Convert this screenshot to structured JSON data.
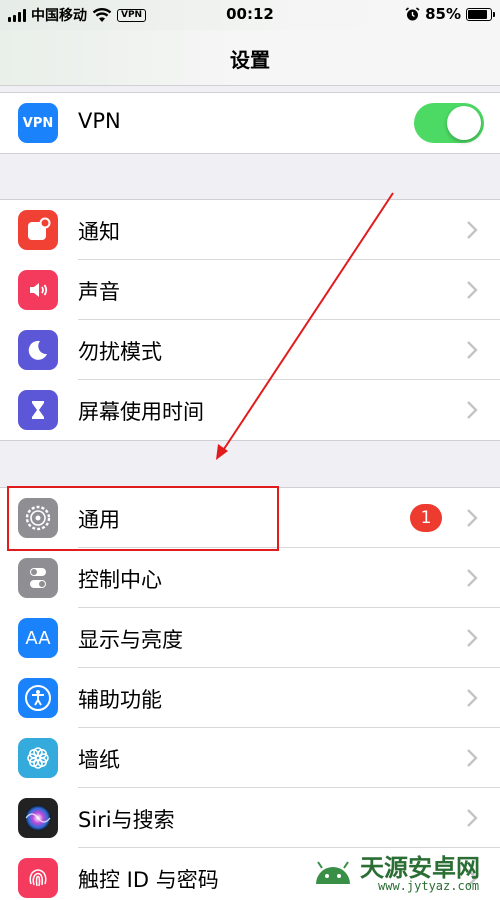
{
  "status_bar": {
    "carrier": "中国移动",
    "vpn_indicator": "VPN",
    "time": "00:12",
    "battery": "85%",
    "battery_level": 0.85,
    "icons": [
      "signal-icon",
      "wifi-icon",
      "alarm-icon",
      "battery-icon"
    ]
  },
  "nav": {
    "title": "设置"
  },
  "vpn_group": [
    {
      "label": "VPN",
      "icon": "vpn-icon",
      "icon_text": "VPN",
      "color": "#1a82fb",
      "toggle_on": true
    }
  ],
  "group1": [
    {
      "label": "通知",
      "icon": "notifications-icon",
      "color": "#f04134"
    },
    {
      "label": "声音",
      "icon": "sound-icon",
      "color": "#f43a5d"
    },
    {
      "label": "勿扰模式",
      "icon": "moon-icon",
      "color": "#5b57d6"
    },
    {
      "label": "屏幕使用时间",
      "icon": "hourglass-icon",
      "color": "#5b57d6"
    }
  ],
  "group2": [
    {
      "label": "通用",
      "icon": "gear-icon",
      "color": "#8e8e93",
      "badge": "1"
    },
    {
      "label": "控制中心",
      "icon": "toggles-icon",
      "color": "#8e8e93"
    },
    {
      "label": "显示与亮度",
      "icon": "display-icon",
      "icon_text": "AA",
      "color": "#1a82fb"
    },
    {
      "label": "辅助功能",
      "icon": "accessibility-icon",
      "color": "#1a82fb"
    },
    {
      "label": "墙纸",
      "icon": "wallpaper-icon",
      "color": "#35aadc"
    },
    {
      "label": "Siri与搜索",
      "icon": "siri-icon",
      "color": "#222222"
    },
    {
      "label": "触控 ID 与密码",
      "icon": "fingerprint-icon",
      "color": "#f43a5d"
    }
  ],
  "watermark": {
    "brand": "天源安卓网",
    "url": "www.jytyaz.com"
  },
  "colors": {
    "toggle_on": "#4cd964",
    "badge": "#ee3b2f",
    "highlight": "#e21c1c"
  }
}
